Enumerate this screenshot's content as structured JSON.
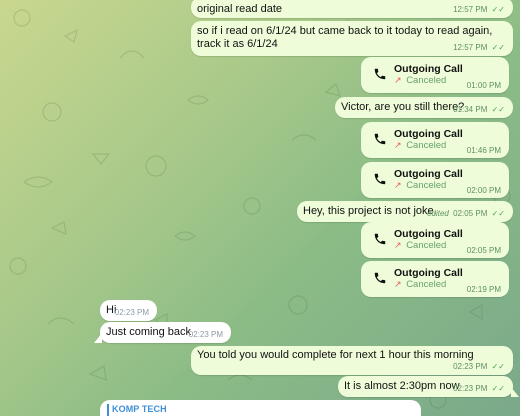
{
  "colors": {
    "outgoing_bubble": "#eefcd9",
    "incoming_bubble": "#ffffff",
    "time_outgoing": "#5f8f64",
    "time_incoming": "#8f9aa6",
    "ticks": "#4ca54b",
    "missed_arrow": "#e35d5d",
    "accent_blue": "#3e8fd8"
  },
  "messages": [
    {
      "text": "original read date",
      "time": "12:57 PM"
    },
    {
      "text": "so if i read on 6/1/24 but came back to it today to read again,\ntrack it as 6/1/24",
      "time": "12:57 PM"
    },
    {
      "title": "Outgoing Call",
      "status": "Canceled",
      "time": "01:00 PM"
    },
    {
      "text": "Victor, are you still there?",
      "time": "01:34 PM"
    },
    {
      "title": "Outgoing Call",
      "status": "Canceled",
      "time": "01:46 PM"
    },
    {
      "title": "Outgoing Call",
      "status": "Canceled",
      "time": "02:00 PM"
    },
    {
      "text": "Hey, this project is not joke.",
      "edited": "edited",
      "time": "02:05 PM"
    },
    {
      "title": "Outgoing Call",
      "status": "Canceled",
      "time": "02:05 PM"
    },
    {
      "title": "Outgoing Call",
      "status": "Canceled",
      "time": "02:19 PM"
    },
    {
      "text": "Hi",
      "time": "02:23 PM"
    },
    {
      "text": "Just coming back",
      "time": "02:23 PM"
    },
    {
      "text": "You told you would complete for next 1 hour this morning",
      "time": "02:23 PM"
    },
    {
      "text": "It is almost 2:30pm now",
      "time": "02:23 PM"
    }
  ],
  "link_preview": {
    "label": "KOMP TECH"
  }
}
